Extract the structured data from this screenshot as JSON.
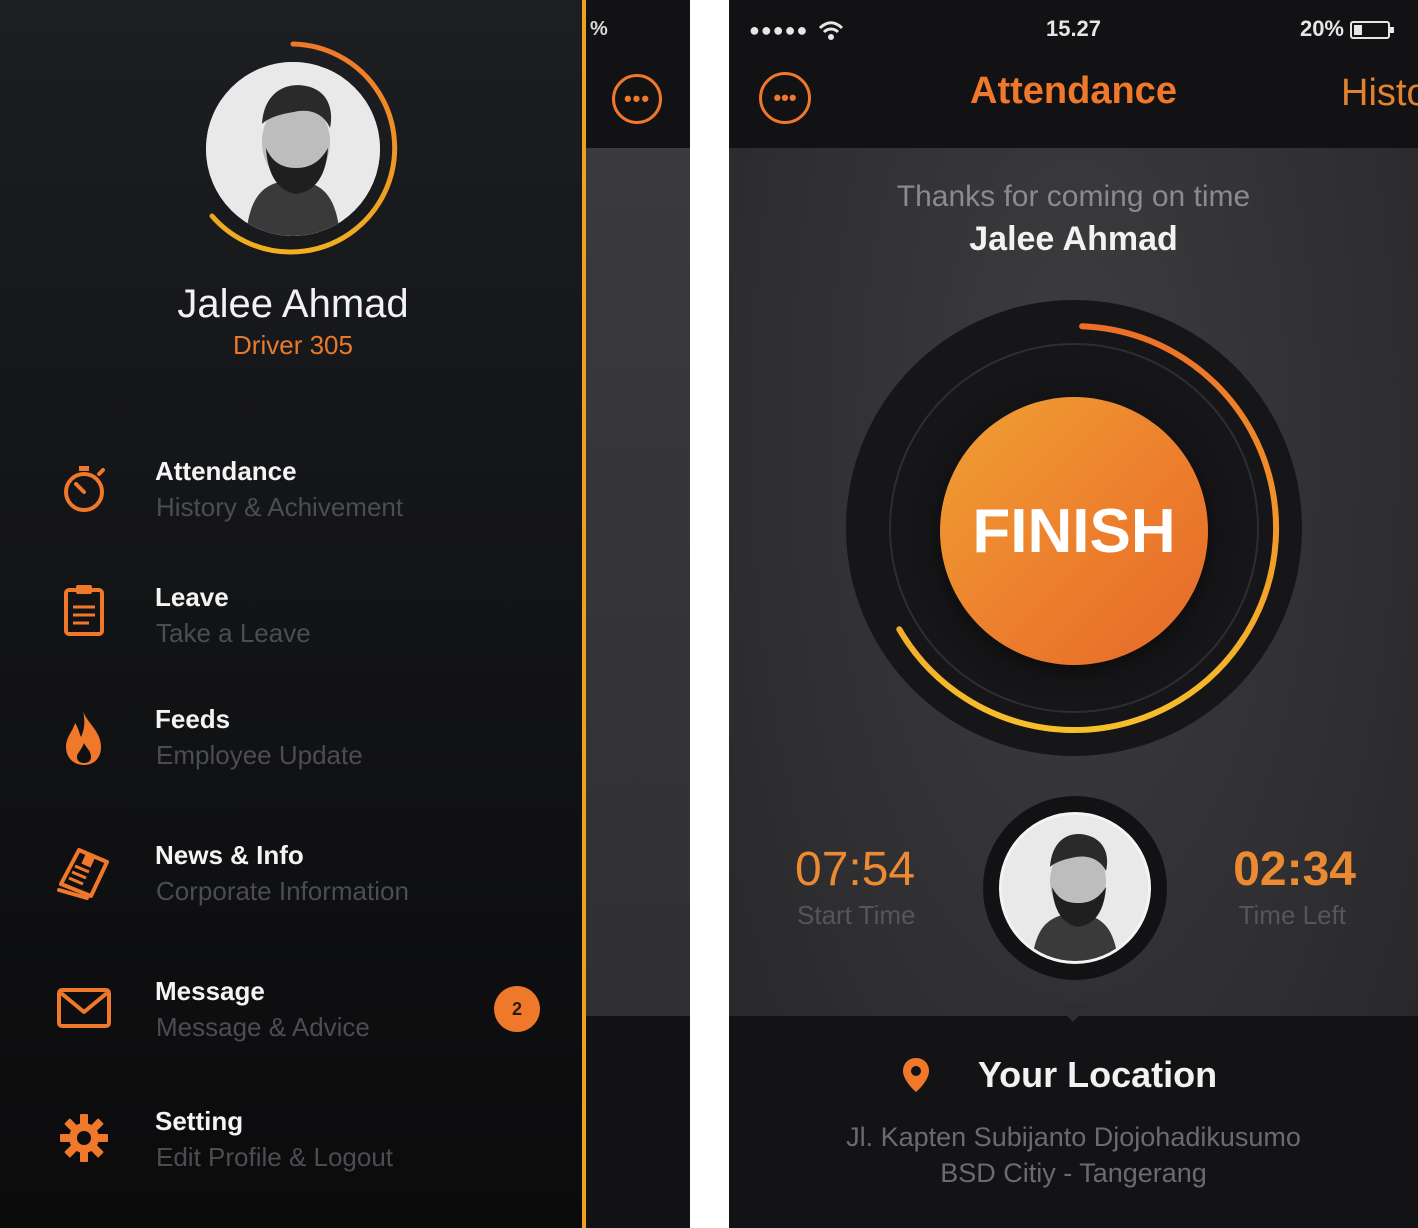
{
  "drawer": {
    "user_name": "Jalee Ahmad",
    "user_role": "Driver 305",
    "items": [
      {
        "title": "Attendance",
        "subtitle": "History & Achivement",
        "icon": "stopwatch-icon"
      },
      {
        "title": "Leave",
        "subtitle": "Take a Leave",
        "icon": "clipboard-icon"
      },
      {
        "title": "Feeds",
        "subtitle": "Employee Update",
        "icon": "flame-icon"
      },
      {
        "title": "News & Info",
        "subtitle": "Corporate Information",
        "icon": "newspaper-icon"
      },
      {
        "title": "Message",
        "subtitle": "Message & Advice",
        "icon": "envelope-icon",
        "badge": "2"
      },
      {
        "title": "Setting",
        "subtitle": "Edit Profile & Logout",
        "icon": "gear-icon"
      }
    ],
    "behind_status": "%"
  },
  "status_bar": {
    "signal": "●●●●●",
    "time": "15.27",
    "battery": "20%"
  },
  "nav": {
    "active_tab": "Attendance",
    "next_tab": "Histo"
  },
  "attendance": {
    "greeting": "Thanks for coming on time",
    "name": "Jalee Ahmad",
    "button_label": "FINISH",
    "progress": 0.66,
    "start_time": "07:54",
    "start_label": "Start Time",
    "time_left": "02:34",
    "time_left_label": "Time Left"
  },
  "location": {
    "title": "Your Location",
    "line1": "Jl. Kapten Subijanto Djojohadikusumo",
    "line2": "BSD Citiy - Tangerang"
  },
  "colors": {
    "accent": "#f0782a",
    "accent_yellow": "#f0a020",
    "dark": "#121214"
  }
}
